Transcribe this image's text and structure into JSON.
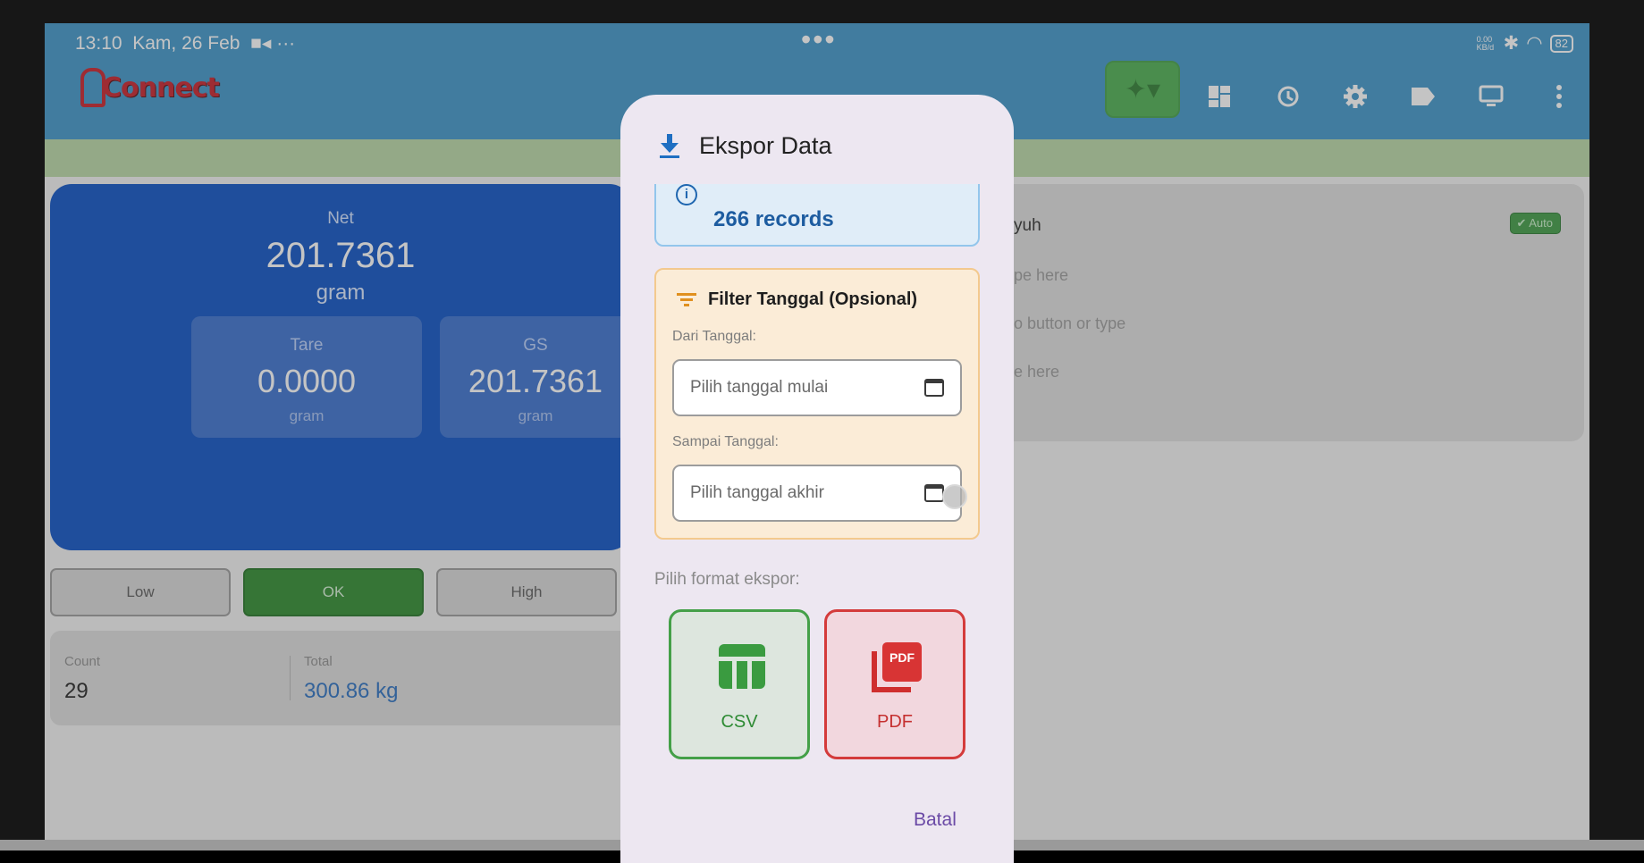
{
  "status_bar": {
    "time": "13:10",
    "date": "Kam, 26 Feb",
    "extra": "■◂ ···",
    "center_dots": "•••",
    "net_speed": "0.00 KB/d",
    "battery": "82"
  },
  "app": {
    "logo_text": "Connect"
  },
  "toolbar": {
    "icons": [
      "active-mode-icon",
      "dashboard-icon",
      "history-icon",
      "settings-icon",
      "label-icon",
      "monitor-icon",
      "more-vert-icon"
    ]
  },
  "net_card": {
    "label": "Net",
    "value": "201.7361",
    "unit": "gram"
  },
  "tare": {
    "label": "Tare",
    "value": "0.0000",
    "unit": "gram"
  },
  "gs": {
    "label": "GS",
    "value": "201.7361",
    "unit": "gram"
  },
  "levels": {
    "low": "Low",
    "ok": "OK",
    "high": "High"
  },
  "stats": {
    "count_label": "Count",
    "count_value": "29",
    "total_label": "Total",
    "total_value": "300.86 kg"
  },
  "panel": {
    "title": "yuh",
    "badge": "Auto",
    "line1": "pe here",
    "line2": "o button or type",
    "line3": "e here"
  },
  "dialog": {
    "title": "Ekspor Data",
    "records": "266 records",
    "filter_title": "Filter Tanggal (Opsional)",
    "from_label": "Dari Tanggal:",
    "from_placeholder": "Pilih tanggal mulai",
    "to_label": "Sampai Tanggal:",
    "to_placeholder": "Pilih tanggal akhir",
    "format_label": "Pilih format ekspor:",
    "csv_label": "CSV",
    "pdf_label": "PDF",
    "pdf_icon_text": "PDF",
    "cancel_label": "Batal"
  },
  "colors": {
    "appbar": "#3f95c9",
    "net_card": "#0d52c4",
    "ok_green": "#2e8b2f",
    "csv_green": "#44a048",
    "pdf_red": "#d43b3b",
    "dialog_bg": "#ede7f1"
  }
}
